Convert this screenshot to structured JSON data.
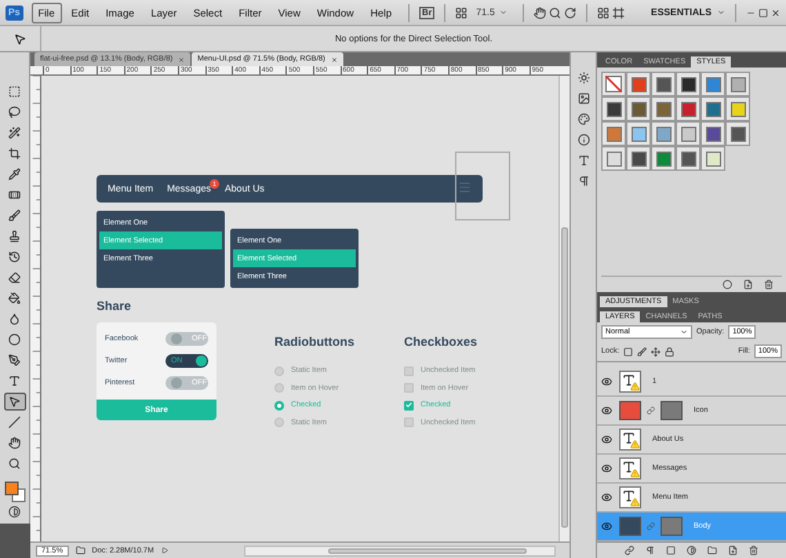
{
  "menubar": {
    "logo": "Ps",
    "menus": [
      {
        "label": "File",
        "selected": true
      },
      {
        "label": "Edit",
        "selected": false
      },
      {
        "label": "Image",
        "selected": false
      },
      {
        "label": "Layer",
        "selected": false
      },
      {
        "label": "Select",
        "selected": false
      },
      {
        "label": "Filter",
        "selected": false
      },
      {
        "label": "View",
        "selected": false
      },
      {
        "label": "Window",
        "selected": false
      },
      {
        "label": "Help",
        "selected": false
      }
    ],
    "bridge": "Br",
    "zoom": "71.5",
    "workspace": "ESSENTIALS"
  },
  "options_bar": {
    "message": "No options for the Direct Selection Tool."
  },
  "tools": [
    {
      "kind": "marquee",
      "selected": false
    },
    {
      "kind": "lasso",
      "selected": false
    },
    {
      "kind": "wand",
      "selected": false
    },
    {
      "kind": "crop",
      "selected": false
    },
    {
      "kind": "eyedropper",
      "selected": false
    },
    {
      "kind": "healing",
      "selected": false
    },
    {
      "kind": "brush",
      "selected": false
    },
    {
      "kind": "stamp",
      "selected": false
    },
    {
      "kind": "history",
      "selected": false
    },
    {
      "kind": "eraser",
      "selected": false
    },
    {
      "kind": "bucket",
      "selected": false
    },
    {
      "kind": "blur",
      "selected": false
    },
    {
      "kind": "dodge",
      "selected": false
    },
    {
      "kind": "pen",
      "selected": false
    },
    {
      "kind": "type",
      "selected": false
    },
    {
      "kind": "select",
      "selected": true
    },
    {
      "kind": "line",
      "selected": false
    },
    {
      "kind": "hand",
      "selected": false
    },
    {
      "kind": "zoom",
      "selected": false
    }
  ],
  "document_tabs": [
    {
      "label": "flat-ui-free.psd @ 13.1% (Body, RGB/8)",
      "selected": false
    },
    {
      "label": "Menu-UI.psd @ 71.5% (Body, RGB/8)",
      "selected": true
    }
  ],
  "ruler_labels": [
    "0",
    "100",
    "150",
    "200",
    "250",
    "300",
    "350",
    "400",
    "450",
    "500",
    "550",
    "600",
    "650",
    "700",
    "750",
    "800",
    "850",
    "900",
    "950"
  ],
  "canvas": {
    "nav": {
      "items": [
        {
          "label": "Menu Item"
        },
        {
          "label": "Messages",
          "badge": "1"
        },
        {
          "label": "About Us"
        }
      ]
    },
    "dropdowns": [
      {
        "items": [
          {
            "label": "Element One",
            "selected": false
          },
          {
            "label": "Element Selected",
            "selected": true
          },
          {
            "label": "Element Three",
            "selected": false
          }
        ]
      },
      {
        "items": [
          {
            "label": "Element One",
            "selected": false
          },
          {
            "label": "Element Selected",
            "selected": true
          },
          {
            "label": "Element Three",
            "selected": false
          }
        ]
      }
    ],
    "share": {
      "title": "Share",
      "toggles": [
        {
          "label": "Facebook",
          "on": false,
          "state": "OFF"
        },
        {
          "label": "Twitter",
          "on": true,
          "state": "ON"
        },
        {
          "label": "Pinterest",
          "on": false,
          "state": "OFF"
        }
      ],
      "button": "Share"
    },
    "radiobuttons": {
      "title": "Radiobuttons",
      "items": [
        {
          "label": "Static Item",
          "selected": false
        },
        {
          "label": "Item on Hover",
          "selected": false
        },
        {
          "label": "Checked",
          "selected": true
        },
        {
          "label": "Static Item",
          "selected": false
        }
      ]
    },
    "checkboxes": {
      "title": "Checkboxes",
      "items": [
        {
          "label": "Unchecked Item",
          "checked": false
        },
        {
          "label": "Item on Hover",
          "checked": false
        },
        {
          "label": "Checked",
          "checked": true
        },
        {
          "label": "Unchecked Item",
          "checked": false
        }
      ]
    }
  },
  "styles_panel": {
    "tabs": [
      {
        "label": "COLOR",
        "selected": false
      },
      {
        "label": "SWATCHES",
        "selected": false
      },
      {
        "label": "STYLES",
        "selected": true
      }
    ],
    "styles": [
      {
        "kind": "none"
      },
      {
        "kind": "fill",
        "color": "#e0401c"
      },
      {
        "kind": "fill",
        "color": "#555555"
      },
      {
        "kind": "fill",
        "color": "#2b2b2b"
      },
      {
        "kind": "fill",
        "color": "#2f86d6"
      },
      {
        "kind": "fill",
        "color": "#b0b0b0"
      },
      {
        "kind": "fill",
        "color": "#3a3a3a"
      },
      {
        "kind": "fill",
        "color": "#6b5a36"
      },
      {
        "kind": "fill",
        "color": "#7b6538"
      },
      {
        "kind": "fill",
        "color": "#c8212e"
      },
      {
        "kind": "fill",
        "color": "#1f6f8f"
      },
      {
        "kind": "fill",
        "color": "#e8d21a"
      },
      {
        "kind": "fill",
        "color": "#d0783a"
      },
      {
        "kind": "fill",
        "color": "#8cc4f0"
      },
      {
        "kind": "fill",
        "color": "#7fa7c8"
      },
      {
        "kind": "fill",
        "color": "#c9c9c9"
      },
      {
        "kind": "fill",
        "color": "#5a4a9a"
      },
      {
        "kind": "fill",
        "color": "#555555"
      },
      {
        "kind": "fill",
        "color": "#dcdcdc"
      },
      {
        "kind": "fill",
        "color": "#4a4a4a"
      },
      {
        "kind": "fill",
        "color": "#0d8a3a"
      },
      {
        "kind": "fill",
        "color": "#555555"
      },
      {
        "kind": "fill",
        "color": "#dfe9c8"
      }
    ]
  },
  "layers_panel": {
    "top_tabs": [
      {
        "label": "ADJUSTMENTS",
        "selected": true
      },
      {
        "label": "MASKS",
        "selected": false
      }
    ],
    "tabs": [
      {
        "label": "LAYERS",
        "selected": true
      },
      {
        "label": "CHANNELS",
        "selected": false
      },
      {
        "label": "PATHS",
        "selected": false
      }
    ],
    "blend_mode": "Normal",
    "opacity_label": "Opacity:",
    "opacity": "100%",
    "lock_label": "Lock:",
    "fill_label": "Fill:",
    "fill": "100%",
    "layers": [
      {
        "name": "1",
        "kind": "text",
        "selected": false
      },
      {
        "name": "Icon",
        "kind": "shape",
        "color": "#e74c3c",
        "selected": false
      },
      {
        "name": "About Us",
        "kind": "text",
        "selected": false
      },
      {
        "name": "Messages",
        "kind": "text",
        "selected": false
      },
      {
        "name": "Menu Item",
        "kind": "text",
        "selected": false
      },
      {
        "name": "Body",
        "kind": "shape",
        "color": "#34495e",
        "selected": true
      }
    ]
  },
  "status_bar": {
    "zoom": "71.5%",
    "doc": "Doc: 2.28M/10.7M"
  }
}
